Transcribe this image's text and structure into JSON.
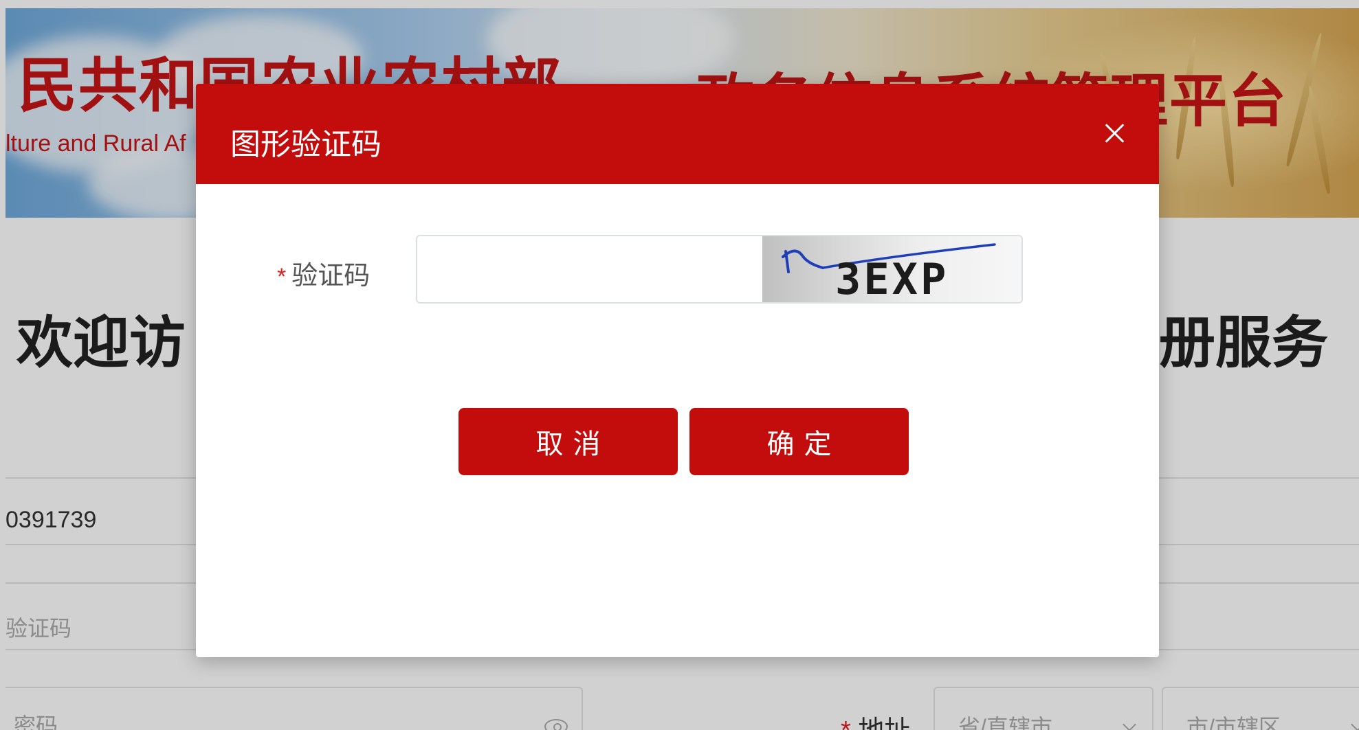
{
  "background": {
    "banner": {
      "title_left": "民共和国农业农村部",
      "subtitle": "lture and Rural Af",
      "title_right": "政务信息系统管理平台"
    },
    "welcome_left": "欢迎访",
    "welcome_right": "册服务",
    "phone_value": "0391739",
    "code_placeholder": "验证码",
    "password_placeholder": "密码",
    "address": {
      "required_mark": "*",
      "label": "地址",
      "province_placeholder": "省/直辖市",
      "city_placeholder": "市/市辖区"
    }
  },
  "dialog": {
    "title": "图形验证码",
    "close_icon": "close-icon",
    "field": {
      "required_mark": "*",
      "label": "验证码",
      "value": "",
      "captcha_text": "3EXP"
    },
    "cancel_label": "取消",
    "confirm_label": "确定"
  },
  "colors": {
    "brand_red": "#c30d0d",
    "required_red": "#e02020"
  }
}
